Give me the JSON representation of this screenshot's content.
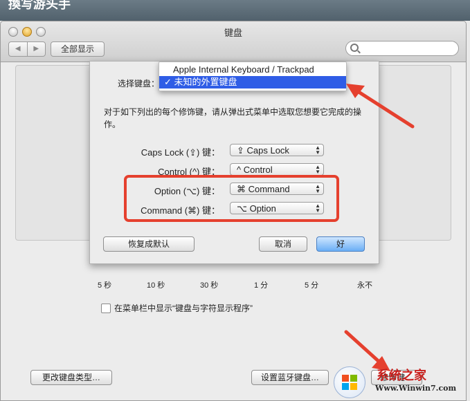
{
  "background": {
    "top_text": "換写游头手"
  },
  "window": {
    "title": "键盘",
    "show_all": "全部显示",
    "nav_back": "◀",
    "nav_forward": "▶"
  },
  "slider": {
    "ticks": [
      "5 秒",
      "10 秒",
      "30 秒",
      "1 分",
      "5 分",
      "永不"
    ]
  },
  "checkbox": {
    "label": "在菜单栏中显示“键盘与字符显示程序”",
    "checked": false
  },
  "bottom_buttons": {
    "change_type": "更改键盘类型…",
    "bluetooth": "设置蓝牙键盘…",
    "modifier": "修饰键…"
  },
  "sheet": {
    "select_label": "选择键盘：",
    "instruction": "对于如下列出的每个修饰键，请从弹出式菜单中选取您想要它完成的操作。",
    "rows": [
      {
        "label": "Caps Lock (⇪) 键：",
        "value": "⇪ Caps Lock"
      },
      {
        "label": "Control (^) 键：",
        "value": "^ Control"
      },
      {
        "label": "Option (⌥) 键：",
        "value": "⌘ Command"
      },
      {
        "label": "Command (⌘) 键：",
        "value": "⌥ Option"
      }
    ],
    "restore_default": "恢复成默认",
    "cancel": "取消",
    "ok": "好"
  },
  "menu": {
    "items": [
      {
        "label": "Apple Internal Keyboard / Trackpad",
        "selected": false
      },
      {
        "label": "未知的外置键盘",
        "selected": true,
        "checkmark": "✓"
      }
    ]
  },
  "watermark": {
    "brand": "系统之家",
    "url": "Www.Winwin7.com"
  },
  "colors": {
    "annotation_red": "#e5402e",
    "menu_highlight": "#2f5de6",
    "default_button": "#6aaef5"
  }
}
